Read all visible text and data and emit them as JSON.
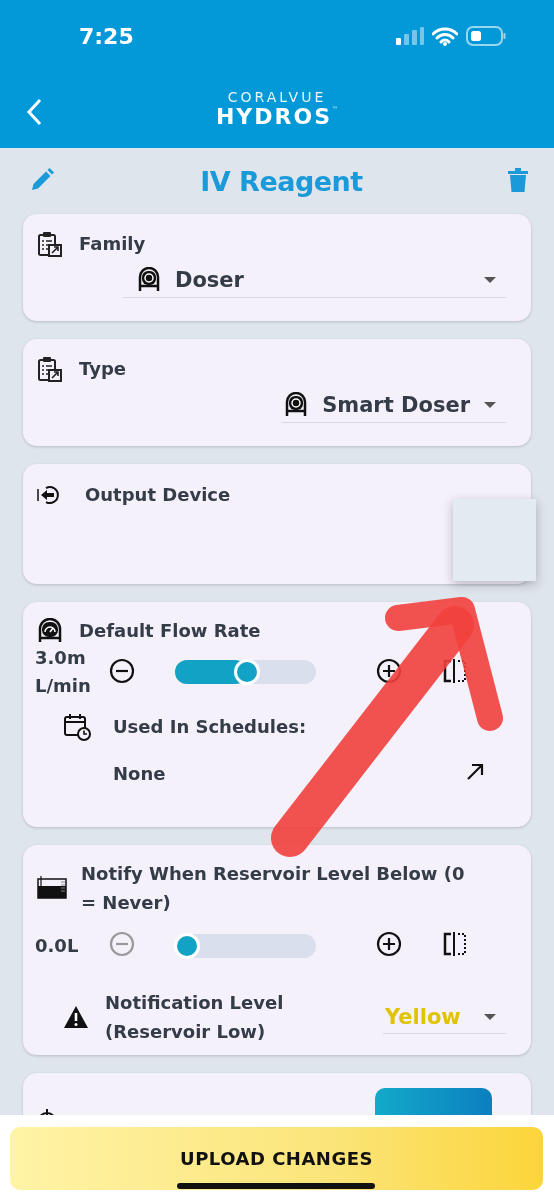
{
  "status_bar": {
    "time": "7:25"
  },
  "header": {
    "brand_top": "CORALVUE",
    "brand": "HYDROS",
    "trademark": "™"
  },
  "title": "IV Reagent",
  "cards": [
    {
      "kind": "select",
      "label": "Family",
      "value": "Doser"
    },
    {
      "kind": "select",
      "label": "Type",
      "value": "Smart Doser"
    },
    {
      "kind": "output",
      "label": "Output Device"
    },
    {
      "kind": "rate",
      "label": "Default Flow Rate",
      "reading": "3.0m L/min",
      "level": 0.51,
      "decrease_disabled": false,
      "schedules_label": "Used In Schedules:",
      "schedules_value": "None"
    },
    {
      "kind": "notify",
      "label": "Notify When Reservoir Level Below (0 = Never)",
      "reading": "0.0L",
      "level": 0,
      "decrease_disabled": true,
      "notification_label": "Notification Level (Reservoir Low)",
      "notification_value": "Yellow"
    },
    {
      "kind": "partial"
    }
  ],
  "upload_button": "UPLOAD CHANGES"
}
